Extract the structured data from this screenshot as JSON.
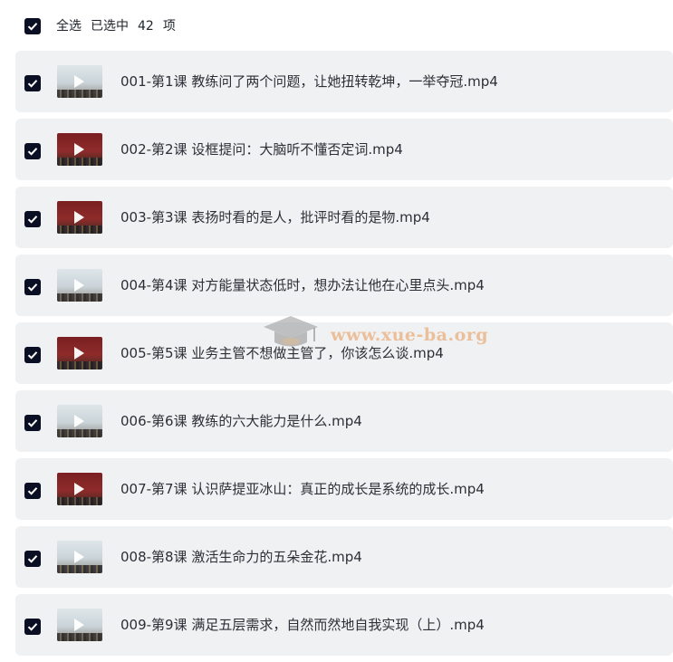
{
  "header": {
    "select_all_label": "全选",
    "selected_label": "已选中",
    "selected_count": "42",
    "unit_label": "项"
  },
  "files": [
    {
      "name": "001-第1课 教练问了两个问题，让她扭转乾坤，一举夺冠.mp4",
      "thumb": "light"
    },
    {
      "name": "002-第2课 设框提问：大脑听不懂否定词.mp4",
      "thumb": "red"
    },
    {
      "name": "003-第3课 表扬时看的是人，批评时看的是物.mp4",
      "thumb": "red"
    },
    {
      "name": "004-第4课 对方能量状态低时，想办法让他在心里点头.mp4",
      "thumb": "light"
    },
    {
      "name": "005-第5课 业务主管不想做主管了，你该怎么谈.mp4",
      "thumb": "red"
    },
    {
      "name": "006-第6课 教练的六大能力是什么.mp4",
      "thumb": "light"
    },
    {
      "name": "007-第7课 认识萨提亚冰山：真正的成长是系统的成长.mp4",
      "thumb": "red"
    },
    {
      "name": "008-第8课 激活生命力的五朵金花.mp4",
      "thumb": "light"
    },
    {
      "name": "009-第9课 满足五层需求，自然而然地自我实现（上）.mp4",
      "thumb": "light"
    }
  ],
  "watermark": {
    "text": "www.xue-ba.org"
  },
  "colors": {
    "checkbox": "#0b0f24",
    "row_background": "#f0f1f3",
    "text": "#2b2f36",
    "watermark": "#e89650"
  }
}
